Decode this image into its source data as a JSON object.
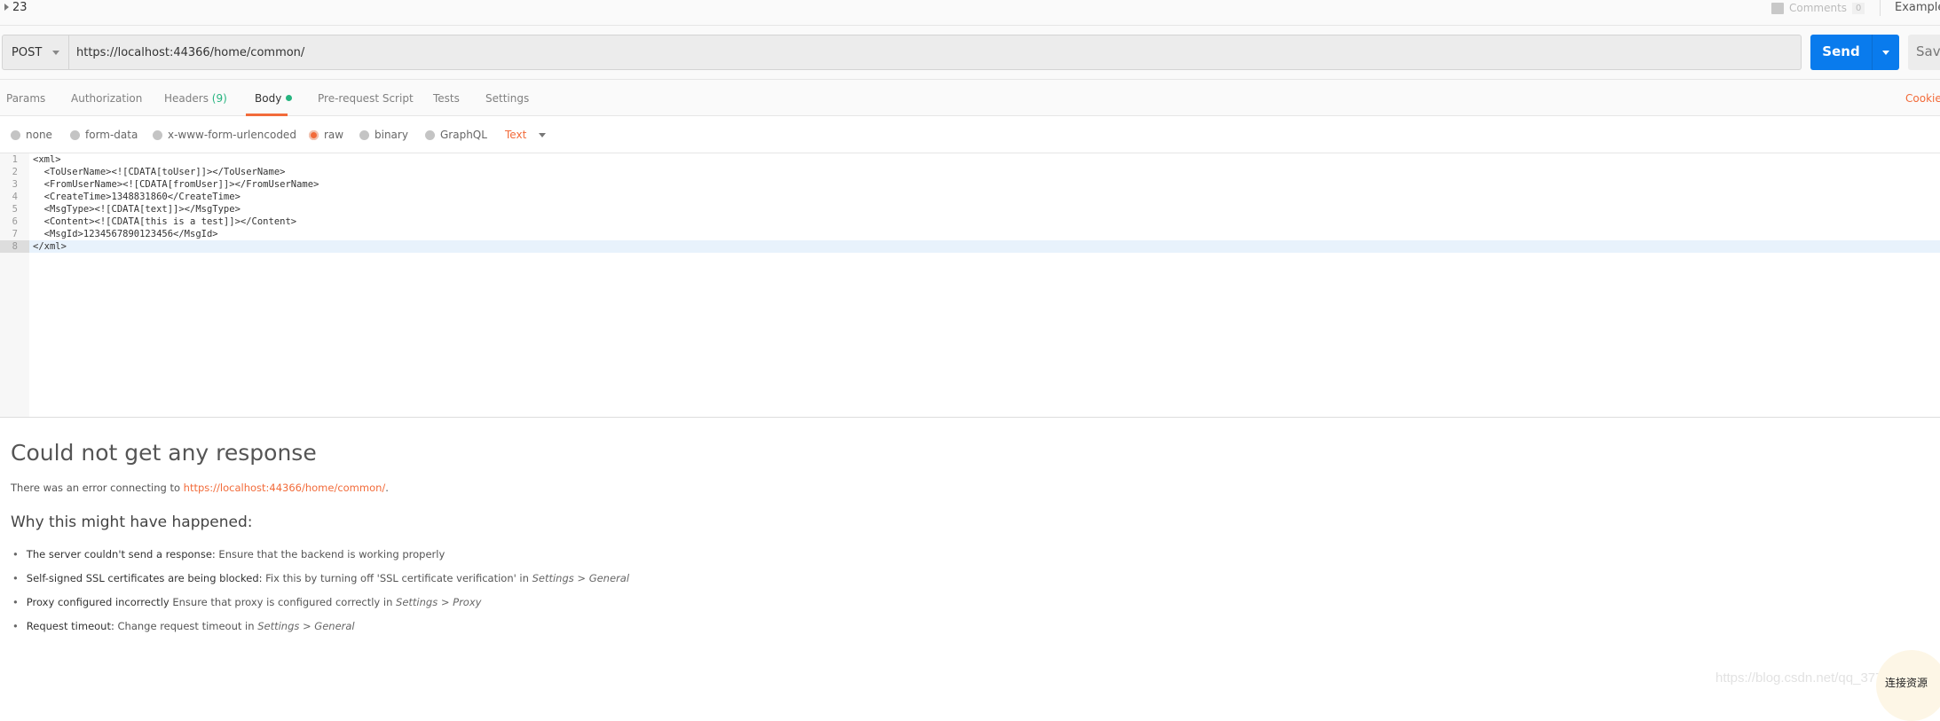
{
  "topbar": {
    "count": "23",
    "comments_label": "Comments",
    "comments_count": "0",
    "examples_label": "Examples"
  },
  "request": {
    "method": "POST",
    "url": "https://localhost:44366/home/common/",
    "send_label": "Send",
    "save_label": "Save"
  },
  "tabs": [
    {
      "label": "Params"
    },
    {
      "label": "Authorization"
    },
    {
      "label": "Headers",
      "count": "(9)"
    },
    {
      "label": "Body",
      "active": true
    },
    {
      "label": "Pre-request Script"
    },
    {
      "label": "Tests"
    },
    {
      "label": "Settings"
    }
  ],
  "cookies_label": "Cookies",
  "body_types": [
    {
      "label": "none"
    },
    {
      "label": "form-data"
    },
    {
      "label": "x-www-form-urlencoded"
    },
    {
      "label": "raw",
      "selected": true
    },
    {
      "label": "binary"
    },
    {
      "label": "GraphQL"
    }
  ],
  "raw_type": "Text",
  "editor_lines": [
    "<xml>",
    "  <ToUserName><![CDATA[toUser]]></ToUserName>",
    "  <FromUserName><![CDATA[fromUser]]></FromUserName>",
    "  <CreateTime>1348831860</CreateTime>",
    "  <MsgType><![CDATA[text]]></MsgType>",
    "  <Content><![CDATA[this is a test]]></Content>",
    "  <MsgId>1234567890123456</MsgId>",
    "</xml>"
  ],
  "response": {
    "title": "Could not get any response",
    "error_prefix": "There was an error connecting to ",
    "error_url": "https://localhost:44366/home/common/",
    "error_suffix": ".",
    "why_title": "Why this might have happened:",
    "reasons": [
      {
        "bold": "The server couldn't send a response:",
        "text": " Ensure that the backend is working properly",
        "em": ""
      },
      {
        "bold": "Self-signed SSL certificates are being blocked:",
        "text": " Fix this by turning off 'SSL certificate verification' in ",
        "em": "Settings > General"
      },
      {
        "bold": "Proxy configured incorrectly",
        "text": " Ensure that proxy is configured correctly in ",
        "em": "Settings > Proxy"
      },
      {
        "bold": "Request timeout:",
        "text": " Change request timeout in ",
        "em": "Settings > General"
      }
    ]
  },
  "watermark": "https://blog.csdn.net/qq_37785390",
  "float_button": "连接资源",
  "colors": {
    "accent": "#f26b3a",
    "send": "#097bed",
    "green": "#26b47f"
  }
}
